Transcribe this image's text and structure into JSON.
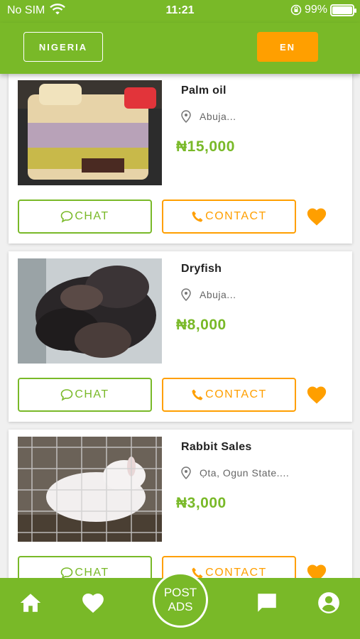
{
  "status_bar": {
    "carrier": "No SIM",
    "time": "11:21",
    "battery": "99%"
  },
  "header": {
    "country": "NIGERIA",
    "language": "EN"
  },
  "listings": [
    {
      "title": "Palm oil",
      "location": "Abuja...",
      "price": "₦15,000",
      "chat_label": "CHAT",
      "contact_label": "CONTACT"
    },
    {
      "title": "Dryfish",
      "location": "Abuja...",
      "price": "₦8,000",
      "chat_label": "CHAT",
      "contact_label": "CONTACT"
    },
    {
      "title": "Rabbit Sales",
      "location": "Ọta, Ogun State....",
      "price": "₦3,000",
      "chat_label": "CHAT",
      "contact_label": "CONTACT"
    }
  ],
  "bottom_nav": {
    "post_line1": "POST",
    "post_line2": "ADS"
  },
  "colors": {
    "brand_green": "#79b928",
    "accent_orange": "#ff9f00"
  }
}
